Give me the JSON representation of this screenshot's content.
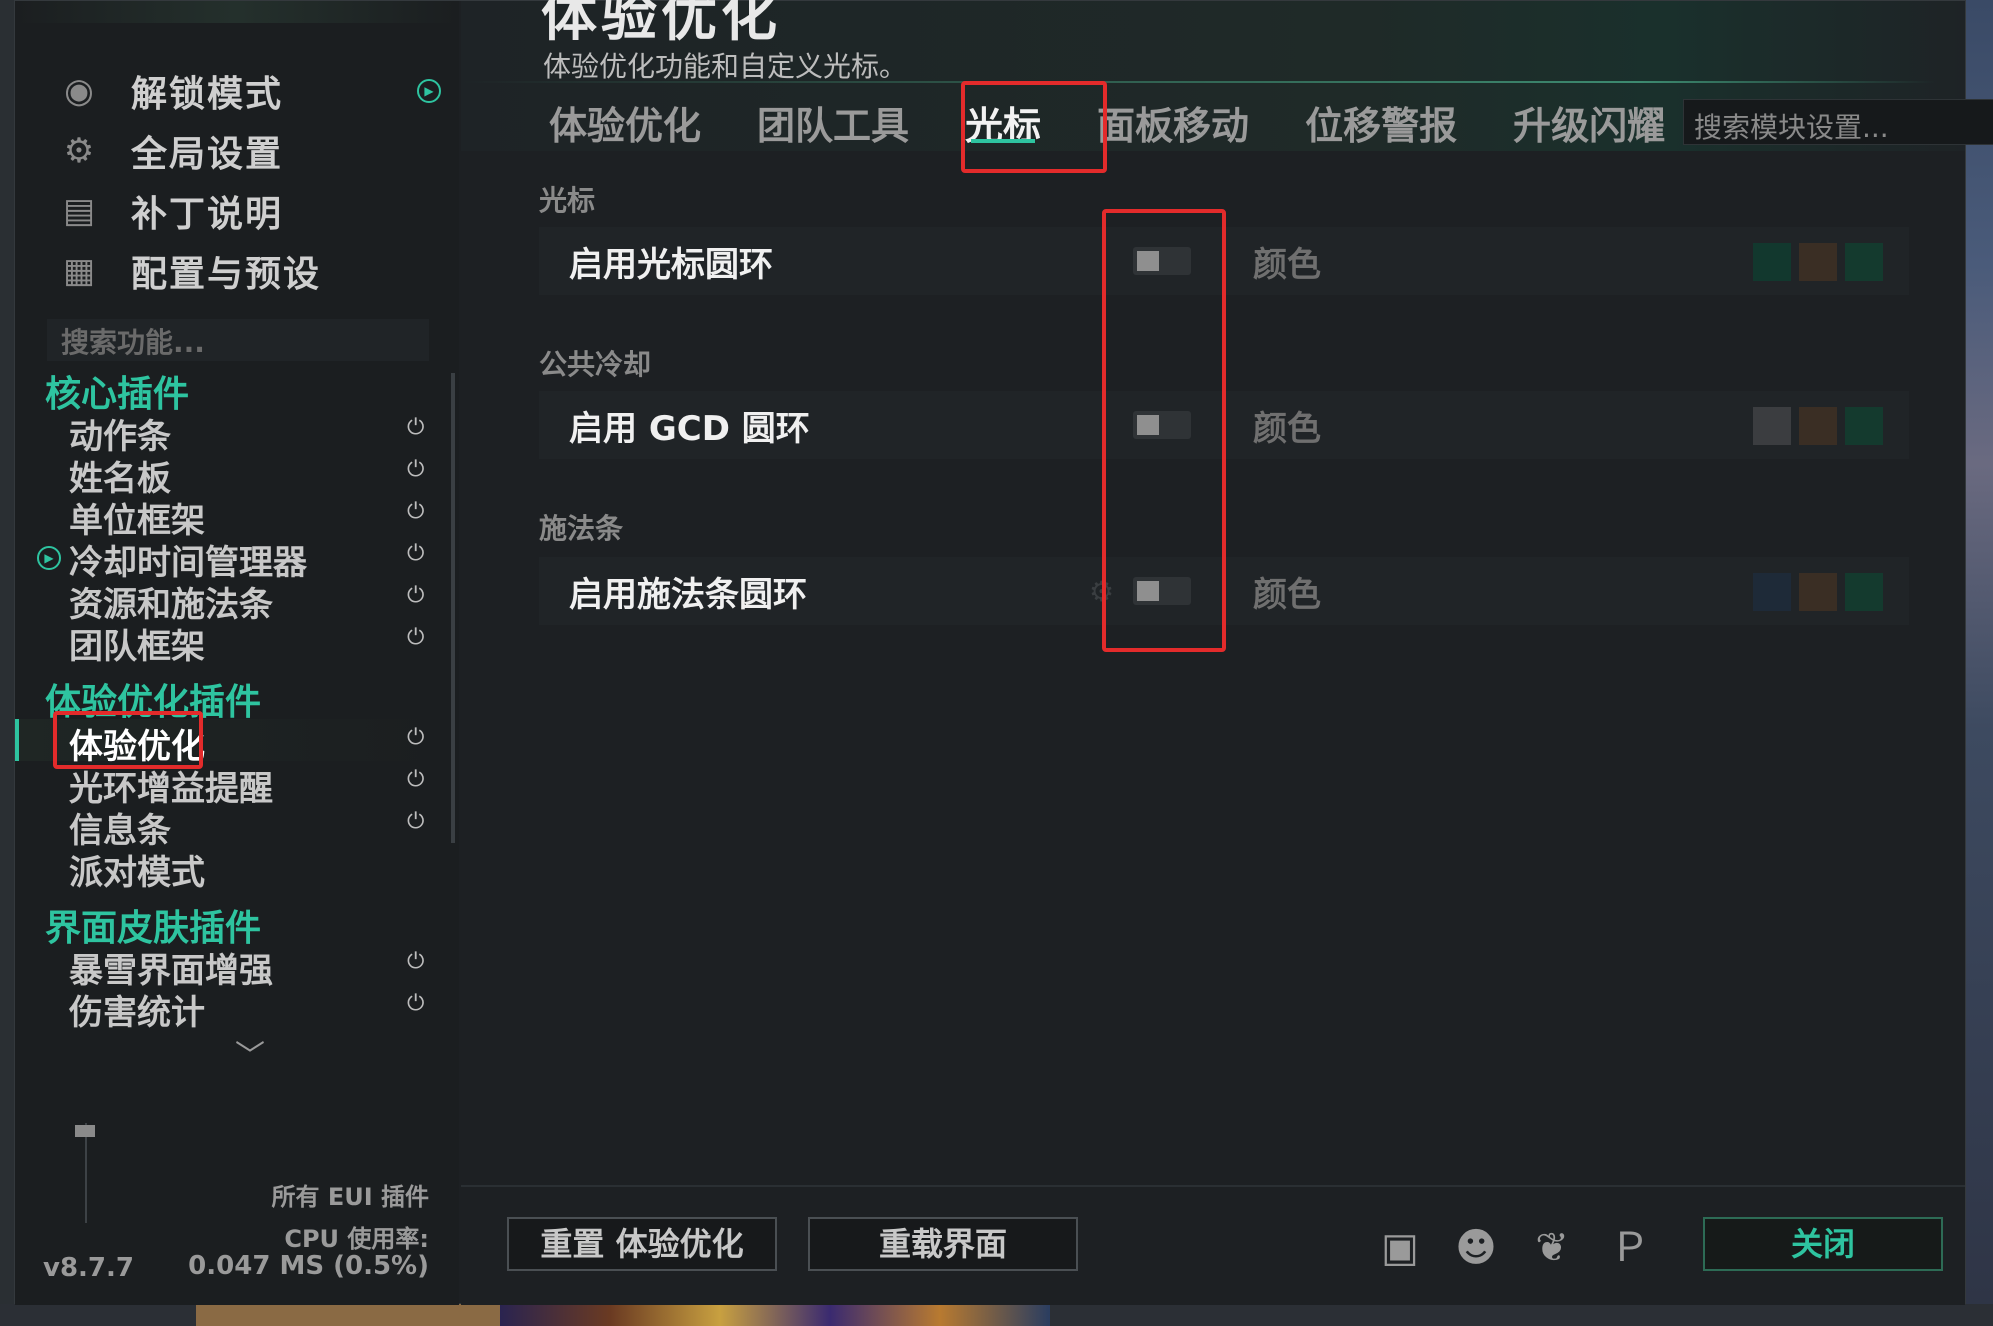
{
  "header": {
    "title": "体验优化",
    "subtitle": "体验优化功能和自定义光标。"
  },
  "tabs": [
    {
      "label": "体验优化",
      "active": false
    },
    {
      "label": "团队工具",
      "active": false
    },
    {
      "label": "光标",
      "active": true
    },
    {
      "label": "面板移动",
      "active": false
    },
    {
      "label": "位移警报",
      "active": false
    },
    {
      "label": "升级闪耀",
      "active": false
    }
  ],
  "module_search": {
    "placeholder": "搜索模块设置..."
  },
  "sections": [
    {
      "title": "光标",
      "row": {
        "label": "启用光标圆环",
        "enabled": false,
        "color_label": "颜色",
        "swatches": [
          "#12382e",
          "#3a2e24",
          "#143a2e"
        ]
      }
    },
    {
      "title": "公共冷却",
      "row": {
        "label": "启用 GCD 圆环",
        "enabled": false,
        "color_label": "颜色",
        "swatches": [
          "#3b3d40",
          "#3a2e24",
          "#143a2e"
        ]
      }
    },
    {
      "title": "施法条",
      "row": {
        "label": "启用施法条圆环",
        "enabled": false,
        "color_label": "颜色",
        "swatches": [
          "#1e2a38",
          "#3a2e24",
          "#143a2e"
        ]
      }
    }
  ],
  "footer": {
    "reset_label": "重置 体验优化",
    "reload_label": "重载界面",
    "close_label": "关闭",
    "social_icons": [
      "twitch-icon",
      "discord-icon",
      "donate-icon",
      "paypal-icon"
    ]
  },
  "sidebar": {
    "nav": [
      {
        "icon": "unlock-mode-icon",
        "label": "解锁模式"
      },
      {
        "icon": "gear-icon",
        "label": "全局设置"
      },
      {
        "icon": "notes-icon",
        "label": "补丁说明"
      },
      {
        "icon": "grid-icon",
        "label": "配置与预设"
      }
    ],
    "search_placeholder": "搜索功能...",
    "categories": [
      {
        "title": "核心插件",
        "items": [
          "动作条",
          "姓名板",
          "单位框架",
          "冷却时间管理器",
          "资源和施法条",
          "团队框架"
        ]
      },
      {
        "title": "体验优化插件",
        "items": [
          "体验优化",
          "光环增益提醒",
          "信息条",
          "派对模式"
        ]
      },
      {
        "title": "界面皮肤插件",
        "items": [
          "暴雪界面增强",
          "伤害统计"
        ]
      }
    ],
    "active_plugin": "体验优化",
    "footer_all": "所有 EUI 插件",
    "footer_cpu_label": "CPU 使用率:",
    "footer_cpu_value": "0.047 MS (0.5%)",
    "version": "v8.7.7"
  },
  "colors": {
    "accent": "#2ec4a0",
    "highlight": "#e32b2b"
  }
}
